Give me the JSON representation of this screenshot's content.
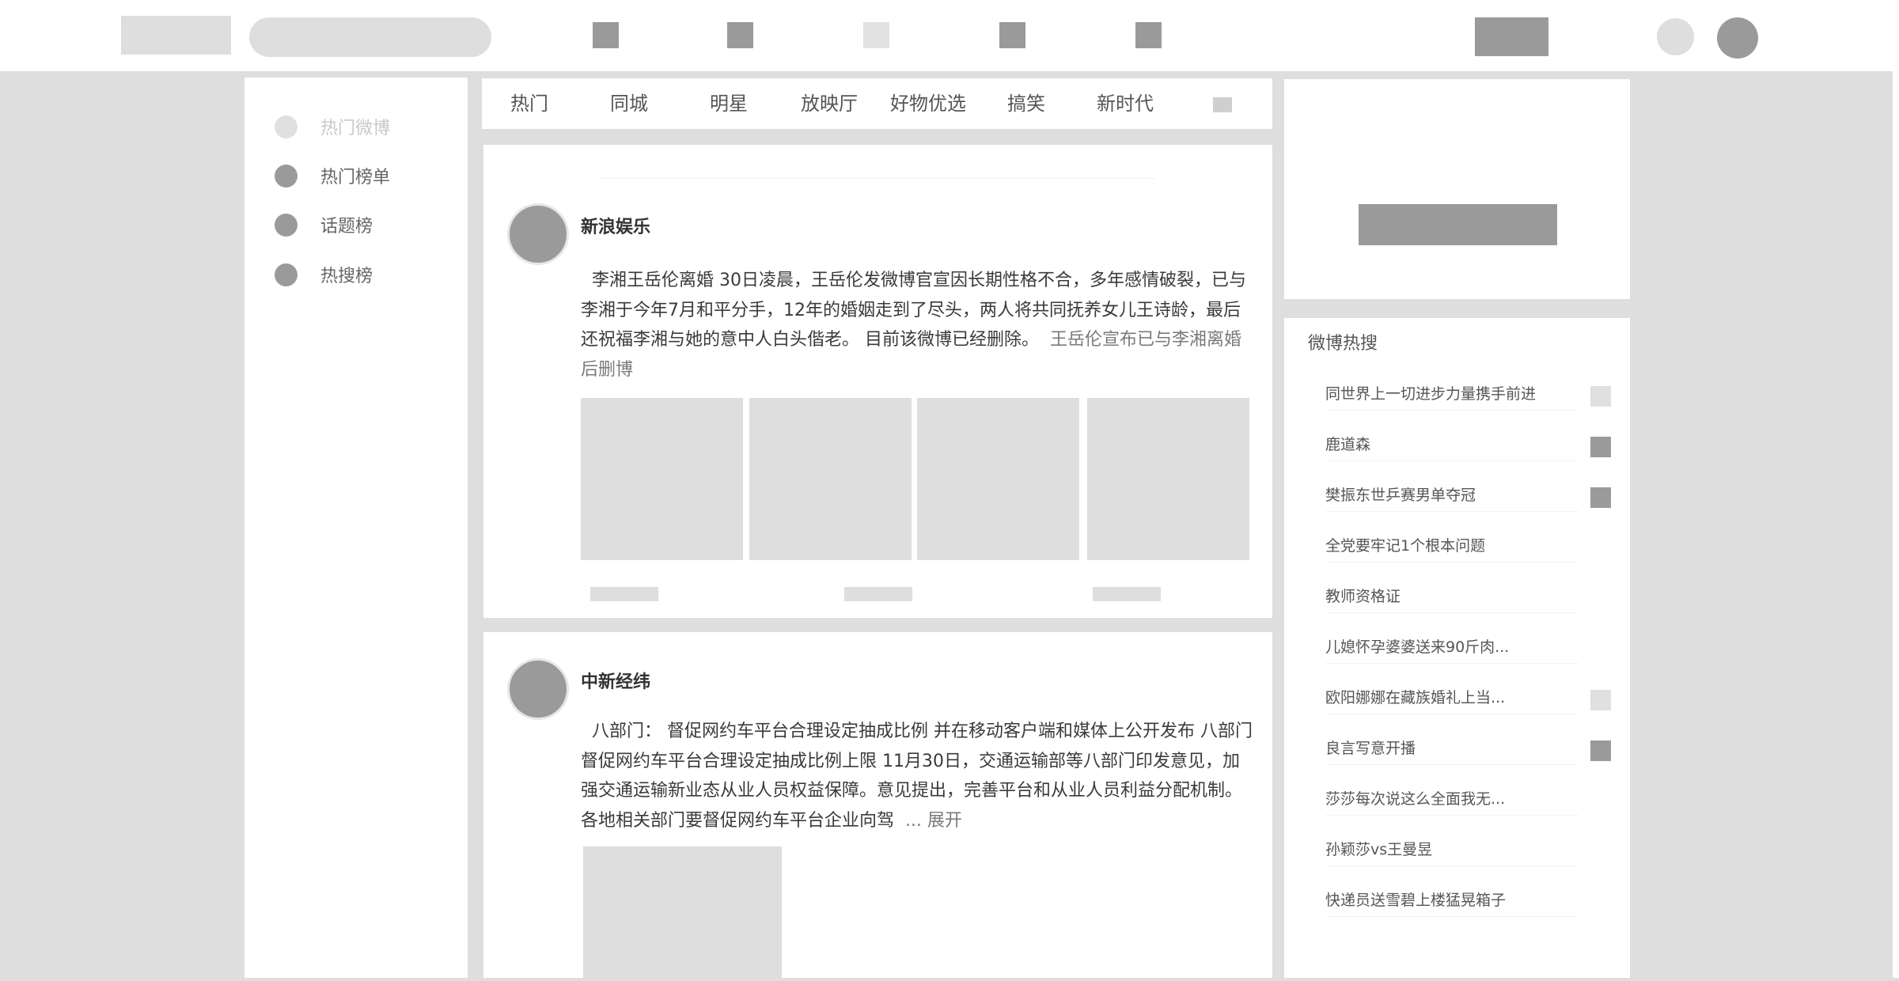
{
  "sidebar": {
    "items": [
      {
        "label": "热门微博"
      },
      {
        "label": "热门榜单"
      },
      {
        "label": "话题榜"
      },
      {
        "label": "热搜榜"
      }
    ]
  },
  "tabs": [
    "热门",
    "同城",
    "明星",
    "放映厅",
    "好物优选",
    "搞笑",
    "新时代"
  ],
  "posts": [
    {
      "author": "新浪娱乐",
      "text_main": "李湘王岳伦离婚  30日凌晨，王岳伦发微博官宣因长期性格不合，多年感情破裂，已与李湘于今年7月和平分手，12年的婚姻走到了尽头，两人将共同抚养女儿王诗龄，最后还祝福李湘与她的意中人白头偕老。 目前该微博已经删除。",
      "text_tail": "王岳伦宣布已与李湘离婚后删博"
    },
    {
      "author": "中新经纬",
      "text_main": "八部门：  督促网约车平台合理设定抽成比例  并在移动客户端和媒体上公开发布       八部门督促网约车平台合理设定抽成比例上限  11月30日，交通运输部等八部门印发意见，加强交通运输新业态从业人员权益保障。意见提出，完善平台和从业人员利益分配机制。各地相关部门要督促网约车平台企业向驾",
      "text_tail": "... 展开"
    }
  ],
  "hot_search": {
    "title": "微博热搜",
    "items": [
      {
        "text": "同世界上一切进步力量携手前进",
        "flag": "light"
      },
      {
        "text": "鹿道森",
        "flag": "dark"
      },
      {
        "text": "樊振东世乒赛男单夺冠",
        "flag": "dark"
      },
      {
        "text": "全党要牢记1个根本问题",
        "flag": "none"
      },
      {
        "text": "教师资格证",
        "flag": "none"
      },
      {
        "text": "儿媳怀孕婆婆送来90斤肉...",
        "flag": "none"
      },
      {
        "text": "欧阳娜娜在藏族婚礼上当...",
        "flag": "light"
      },
      {
        "text": "良言写意开播",
        "flag": "dark"
      },
      {
        "text": "莎莎每次说这么全面我无...",
        "flag": "none"
      },
      {
        "text": "孙颖莎vs王曼昱",
        "flag": "none"
      },
      {
        "text": "快递员送雪碧上楼猛晃箱子",
        "flag": "none"
      }
    ]
  }
}
